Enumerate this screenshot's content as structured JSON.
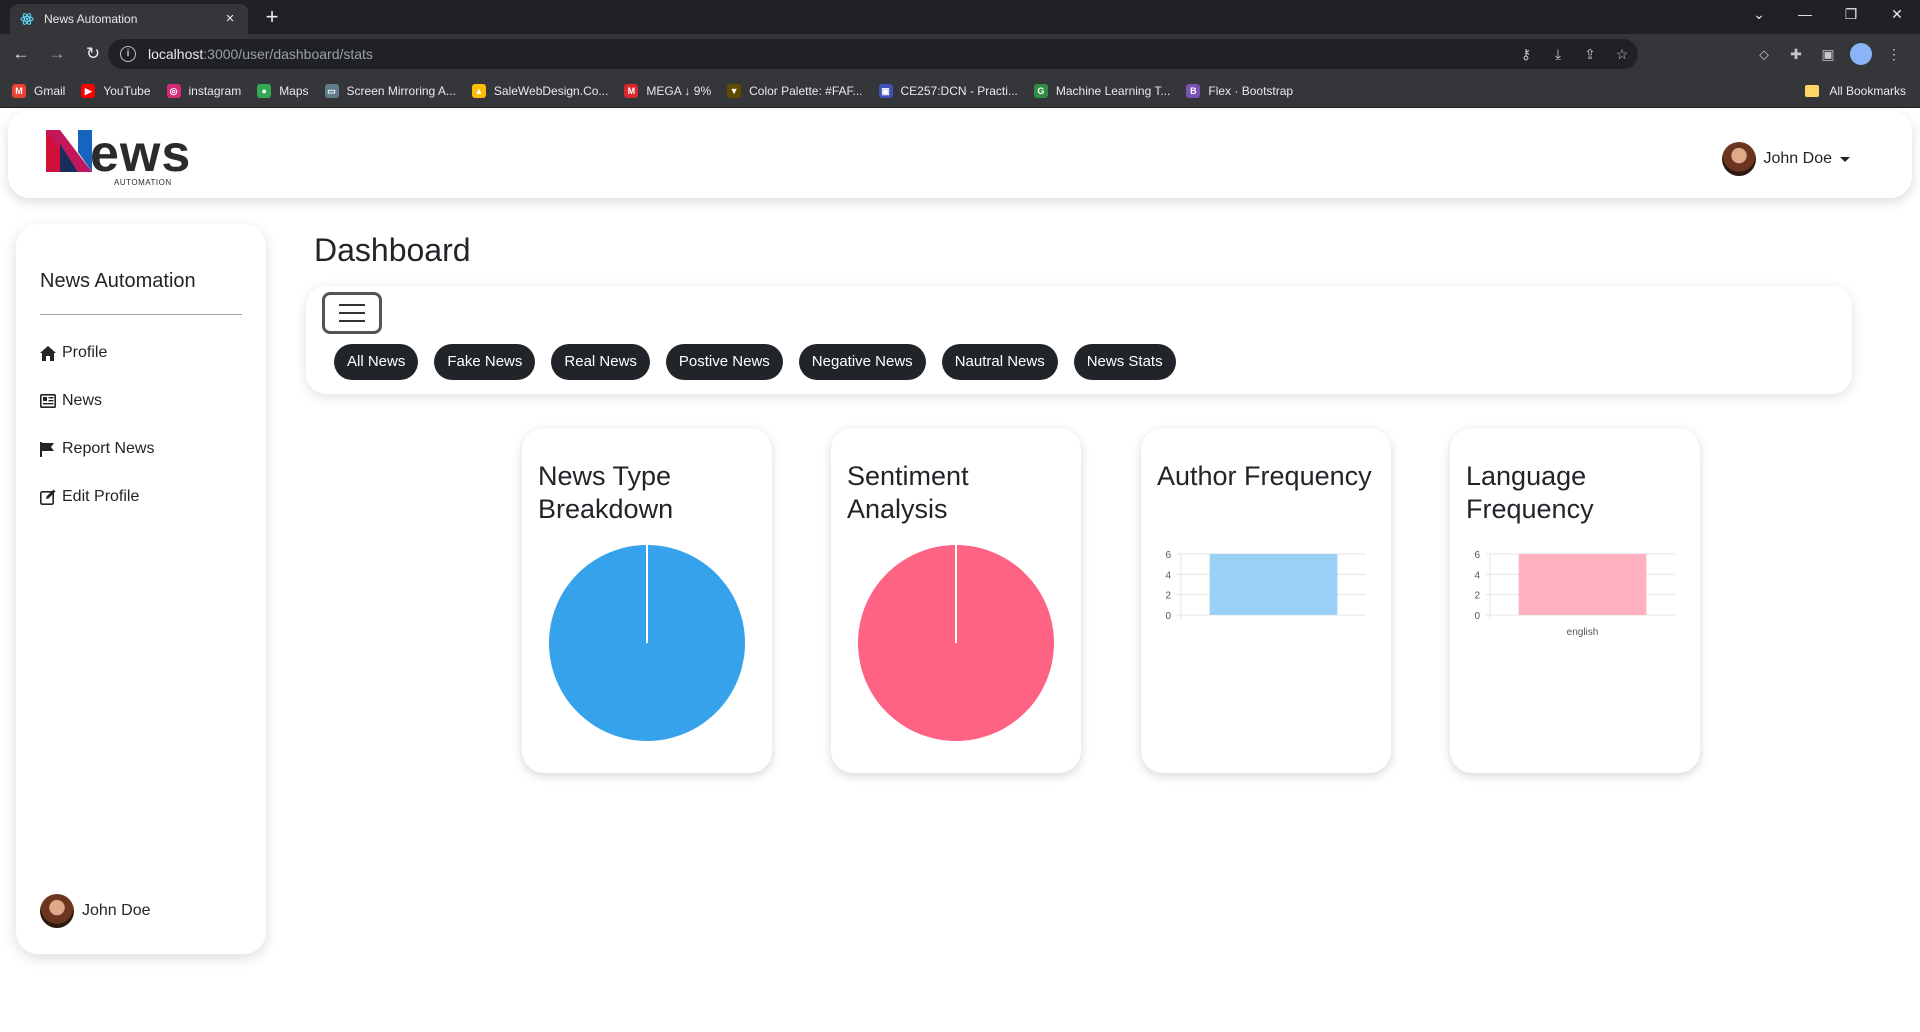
{
  "browser": {
    "tab_title": "News Automation",
    "new_tab": "+",
    "url_host": "localhost",
    "url_path": ":3000/user/dashboard/stats",
    "bookmarks": [
      {
        "label": "Gmail",
        "color": "#ea4335",
        "glyph": "M"
      },
      {
        "label": "YouTube",
        "color": "#ff0000",
        "glyph": "▶"
      },
      {
        "label": "instagram",
        "color": "#d62976",
        "glyph": "◎"
      },
      {
        "label": "Maps",
        "color": "#34a853",
        "glyph": "●"
      },
      {
        "label": "Screen Mirroring A...",
        "color": "#607d8b",
        "glyph": "▭"
      },
      {
        "label": "SaleWebDesign.Co...",
        "color": "#fbbc04",
        "glyph": "▲"
      },
      {
        "label": "MEGA ↓ 9%",
        "color": "#d9272e",
        "glyph": "M"
      },
      {
        "label": "Color Palette: #FAF...",
        "color": "#5f4b00",
        "glyph": "▼"
      },
      {
        "label": "CE257:DCN - Practi...",
        "color": "#3f51b5",
        "glyph": "▣"
      },
      {
        "label": "Machine Learning T...",
        "color": "#2f8d46",
        "glyph": "G"
      },
      {
        "label": "Flex · Bootstrap",
        "color": "#7952b3",
        "glyph": "B"
      }
    ],
    "all_bookmarks": "All Bookmarks"
  },
  "header": {
    "logo_word": "ews",
    "logo_sub": "AUTOMATION",
    "user_name": "John Doe"
  },
  "sidebar": {
    "brand": "News Automation",
    "items": [
      {
        "label": "Profile",
        "icon": "home-icon"
      },
      {
        "label": "News",
        "icon": "newspaper-icon"
      },
      {
        "label": "Report News",
        "icon": "flag-icon"
      },
      {
        "label": "Edit Profile",
        "icon": "edit-icon"
      }
    ],
    "footer_user": "John Doe"
  },
  "main": {
    "title": "Dashboard",
    "filters": [
      "All News",
      "Fake News",
      "Real News",
      "Postive News",
      "Negative News",
      "Nautral News",
      "News Stats"
    ]
  },
  "cards": [
    {
      "title": "News Type Breakdown"
    },
    {
      "title": "Sentiment Analysis"
    },
    {
      "title": "Author Frequency"
    },
    {
      "title": "Language Frequency"
    }
  ],
  "chart_data": [
    {
      "type": "pie",
      "title": "News Type Breakdown",
      "values": [
        1
      ],
      "colors": [
        "#36a2eb"
      ]
    },
    {
      "type": "pie",
      "title": "Sentiment Analysis",
      "values": [
        1
      ],
      "colors": [
        "#ff6384"
      ]
    },
    {
      "type": "bar",
      "title": "Author Frequency",
      "categories": [
        ""
      ],
      "values": [
        6
      ],
      "ylim": [
        0,
        6
      ],
      "yticks": [
        "0",
        "2",
        "4",
        "6"
      ],
      "color": "#9ad0f5",
      "border": "#36a2eb"
    },
    {
      "type": "bar",
      "title": "Language Frequency",
      "categories": [
        "english"
      ],
      "values": [
        6
      ],
      "ylim": [
        0,
        6
      ],
      "yticks": [
        "0",
        "2",
        "4",
        "6"
      ],
      "color": "#ffb1c1",
      "border": "#ff6384"
    }
  ]
}
